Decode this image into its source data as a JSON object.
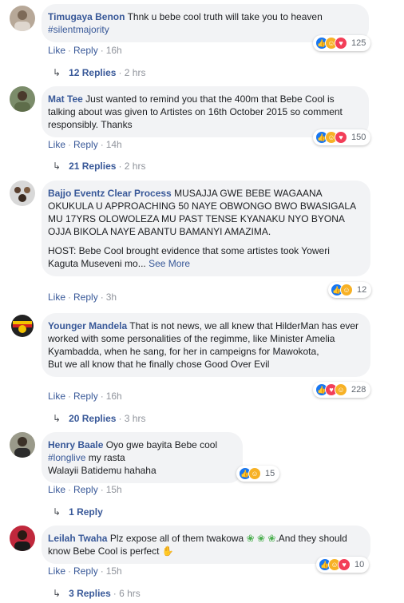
{
  "comments": [
    {
      "author": "Timugaya Benon",
      "text": "Thnk u bebe cool truth will take you to heaven",
      "hashtag": "#silentmajority",
      "like": "Like",
      "reply": "Reply",
      "time": "16h",
      "reactions": "125",
      "replies_label": "12 Replies",
      "replies_time": "2 hrs"
    },
    {
      "author": "Mat Tee",
      "text": "Just wanted to remind you that the 400m that Bebe Cool is talking about was given to Artistes on 16th October 2015 so comment responsibly. Thanks",
      "like": "Like",
      "reply": "Reply",
      "time": "14h",
      "reactions": "150",
      "replies_label": "21 Replies",
      "replies_time": "2 hrs"
    },
    {
      "author": "Bajjo Eventz Clear Process",
      "text": "MUSAJJA GWE BEBE WAGAANA OKUKULA U APPROACHING 50 NAYE OBWONGO BWO BWASIGALA MU 17YRS OLOWOLEZA MU PAST TENSE KYANAKU NYO BYONA OJJA BIKOLA NAYE ABANTU BAMANYI AMAZIMA.",
      "text2": "HOST: Bebe Cool brought evidence that some artistes took Yoweri Kaguta Museveni mo...",
      "see_more": "See More",
      "like": "Like",
      "reply": "Reply",
      "time": "3h",
      "reactions": "12"
    },
    {
      "author": "Younger Mandela",
      "text": "That is not news, we all knew that HilderMan has ever worked with some personalities of the regimme, like Minister Amelia Kyambadda, when he sang, for her in campeigns for Mawokota,",
      "text2": "But we all know that he finally chose Good Over Evil",
      "like": "Like",
      "reply": "Reply",
      "time": "16h",
      "reactions": "228",
      "replies_label": "20 Replies",
      "replies_time": "3 hrs"
    },
    {
      "author": "Henry Baale",
      "text": "Oyo gwe bayita Bebe cool",
      "hashtag": "#longlive",
      "text_after_hashtag": "my rasta",
      "text2": "Walayii Batidemu hahaha",
      "like": "Like",
      "reply": "Reply",
      "time": "15h",
      "reactions": "15",
      "replies_label": "1 Reply"
    },
    {
      "author": "Leilah Twaha",
      "text": "Plz expose all of them twakowa",
      "text_mid": ".And they should know Bebe Cool is perfect",
      "like": "Like",
      "reply": "Reply",
      "time": "15h",
      "reactions": "10",
      "replies_label": "3 Replies",
      "replies_time": "6 hrs"
    }
  ],
  "colors": {
    "link": "#385898",
    "bubble": "#f2f3f5",
    "like": "#1877f2",
    "haha": "#f7b125",
    "love": "#f33e58"
  }
}
